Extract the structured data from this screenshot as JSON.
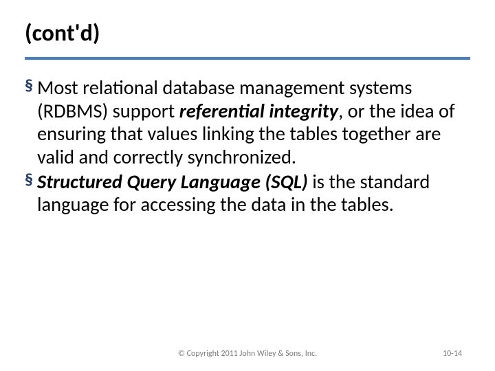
{
  "title": "(cont'd)",
  "bullets": [
    {
      "prefix": "Most",
      "mid1": " relational database management systems (RDBMS) support ",
      "em1": "referential integrity",
      "tail": ", or the idea of ensuring that values linking the tables together are valid and correctly synchronized."
    },
    {
      "em1": "Structured Query Language (SQL)",
      "tail": " is the standard language for accessing the data in the tables."
    }
  ],
  "copyright": "© Copyright 2011 John Wiley & Sons, Inc.",
  "pageNumber": "10-14"
}
